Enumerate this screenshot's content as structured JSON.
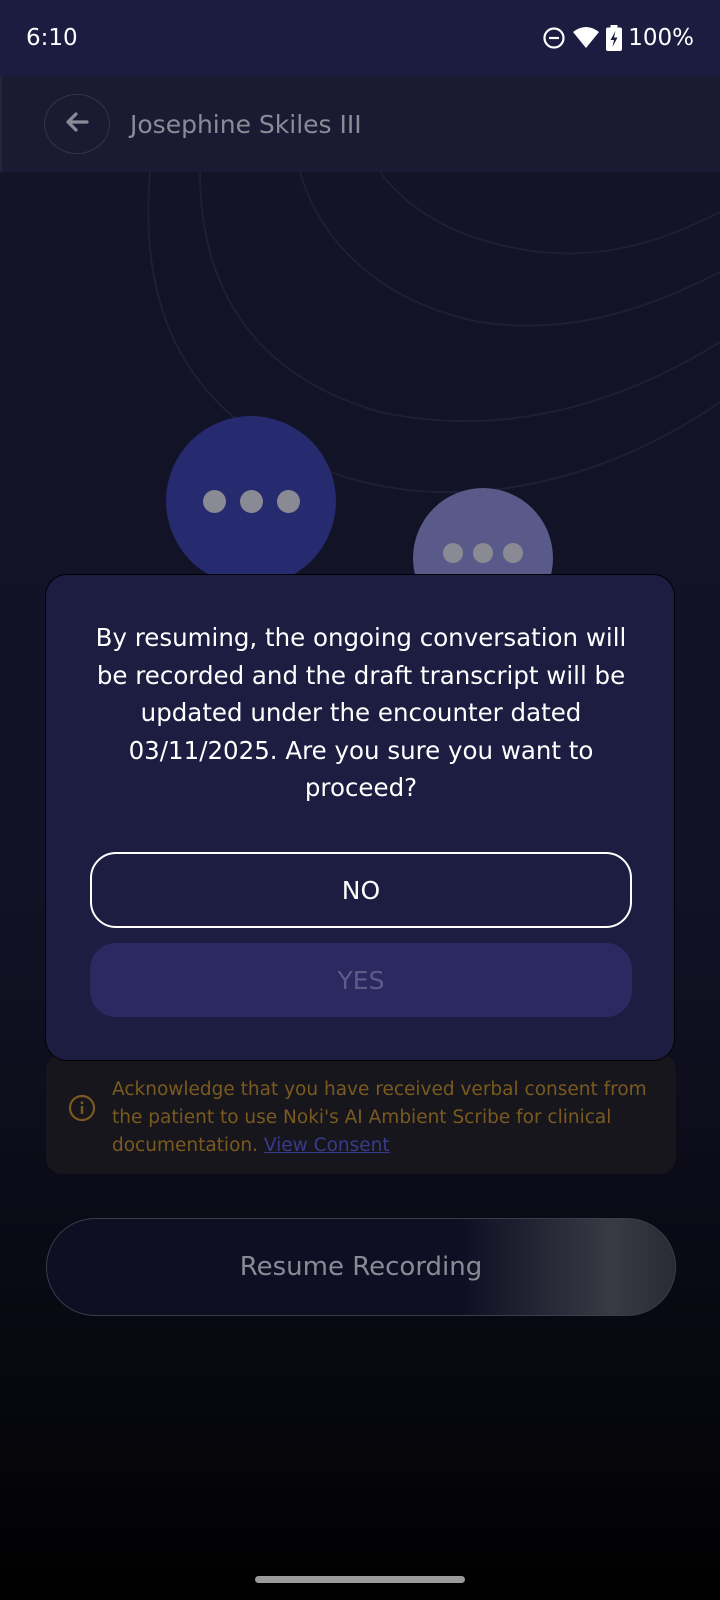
{
  "status_bar": {
    "time": "6:10",
    "battery": "100%",
    "icons": [
      "do-not-disturb-icon",
      "wifi-icon",
      "battery-charging-icon"
    ]
  },
  "header": {
    "title": "Josephine Skiles III",
    "back_icon": "arrow-left-icon"
  },
  "dialog": {
    "message": "By resuming, the ongoing conversation will be recorded and the draft transcript will be updated under the encounter dated 03/11/2025. Are you sure you want to proceed?",
    "no_label": "NO",
    "yes_label": "YES"
  },
  "consent": {
    "text": "Acknowledge that you have received verbal consent from the patient to use Noki's AI Ambient Scribe for clinical documentation.",
    "link_label": "View Consent",
    "icon": "info-icon"
  },
  "resume_button": {
    "label": "Resume Recording"
  },
  "colors": {
    "status_bar": "#1c1c40",
    "dialog_bg": "#1d1c41",
    "yes_button_bg": "#2a2960",
    "consent_text": "#7a5a1e",
    "consent_link": "#3a3a8c",
    "bubble_primary": "#262a6e",
    "bubble_secondary": "#5a5a8a"
  }
}
